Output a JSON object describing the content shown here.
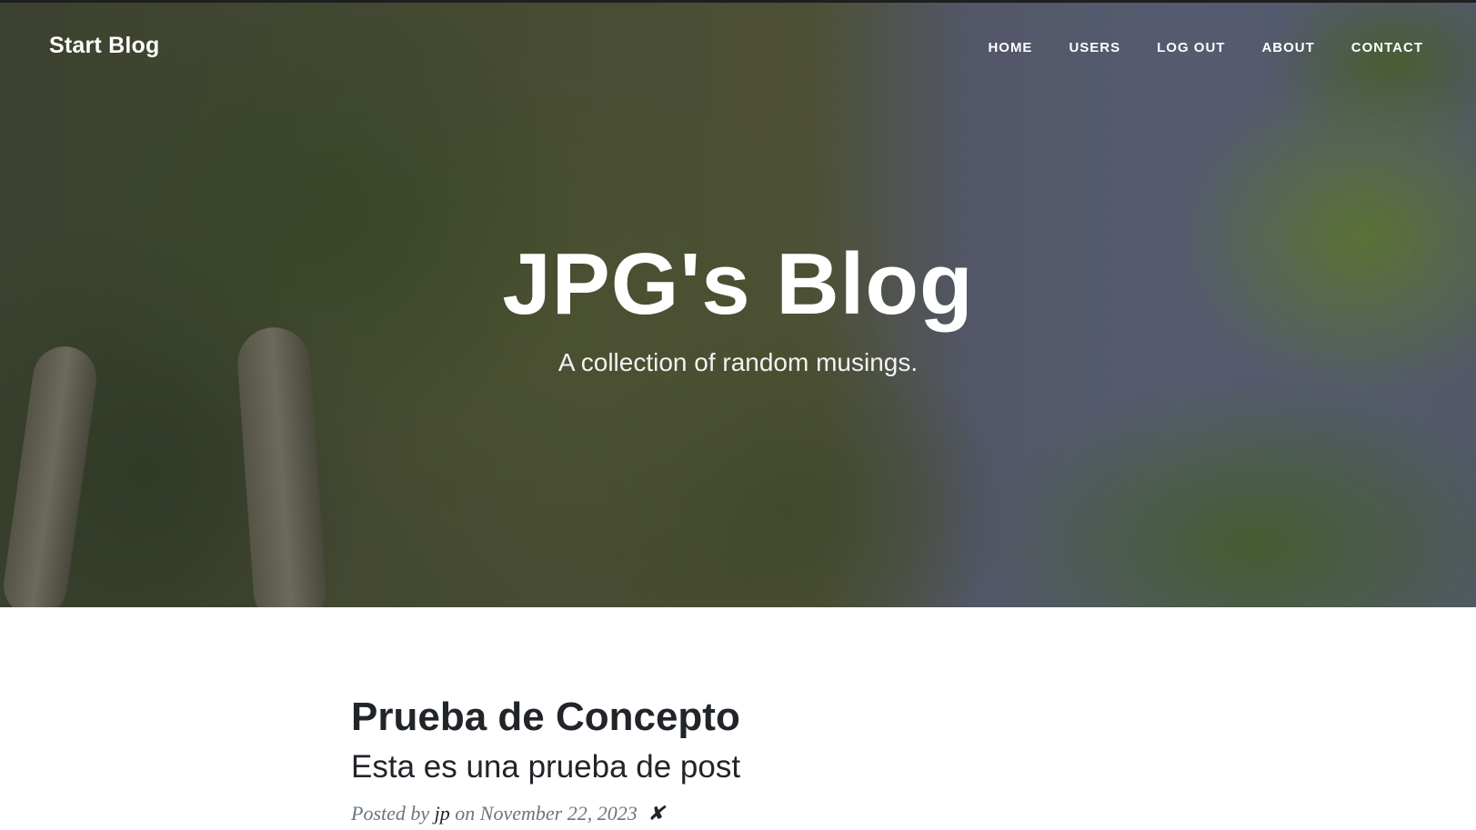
{
  "nav": {
    "brand": "Start Blog",
    "links": [
      "HOME",
      "USERS",
      "LOG OUT",
      "ABOUT",
      "CONTACT"
    ]
  },
  "hero": {
    "title": "JPG's Blog",
    "subtitle": "A collection of random musings."
  },
  "post": {
    "title": "Prueba de Concepto",
    "subtitle": "Esta es una prueba de post",
    "meta_prefix": "Posted by",
    "author": "jp",
    "meta_on": "on",
    "date": "November 22, 2023",
    "delete_label": "✘"
  },
  "colors": {
    "heading_text": "#212529",
    "meta_text": "#6c757d",
    "hero_text": "#ffffff"
  }
}
